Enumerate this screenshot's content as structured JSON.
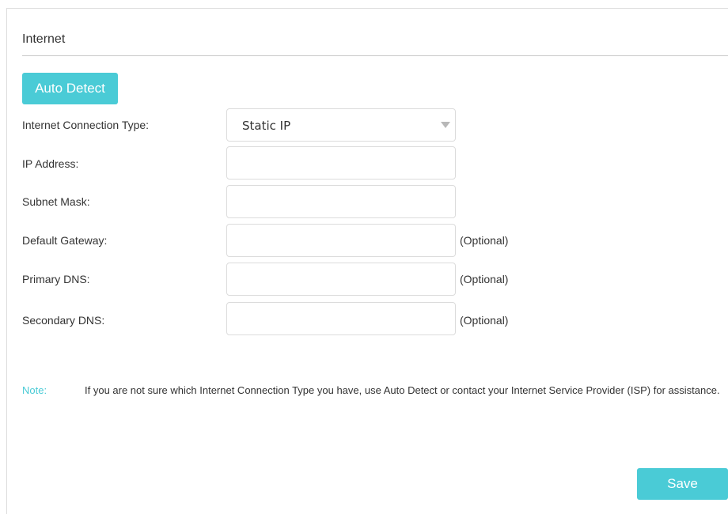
{
  "section": {
    "title": "Internet"
  },
  "auto_detect": {
    "label": "Auto Detect"
  },
  "form": {
    "connection_type": {
      "label": "Internet Connection Type:",
      "selected": "Static IP"
    },
    "ip_address": {
      "label": "IP Address:",
      "value": ""
    },
    "subnet_mask": {
      "label": "Subnet Mask:",
      "value": ""
    },
    "default_gateway": {
      "label": "Default Gateway:",
      "value": "",
      "hint": "(Optional)"
    },
    "primary_dns": {
      "label": "Primary DNS:",
      "value": "",
      "hint": "(Optional)"
    },
    "secondary_dns": {
      "label": "Secondary DNS:",
      "value": "",
      "hint": "(Optional)"
    }
  },
  "note": {
    "label": "Note:",
    "text": "If you are not sure which Internet Connection Type you have, use Auto Detect or contact your Internet Service Provider (ISP) for assistance."
  },
  "save": {
    "label": "Save"
  },
  "theme": {
    "accent": "#4acbd6",
    "text": "#333333",
    "border": "#dcdcdc"
  },
  "icons": {
    "dropdown": "chevron-down-icon"
  }
}
